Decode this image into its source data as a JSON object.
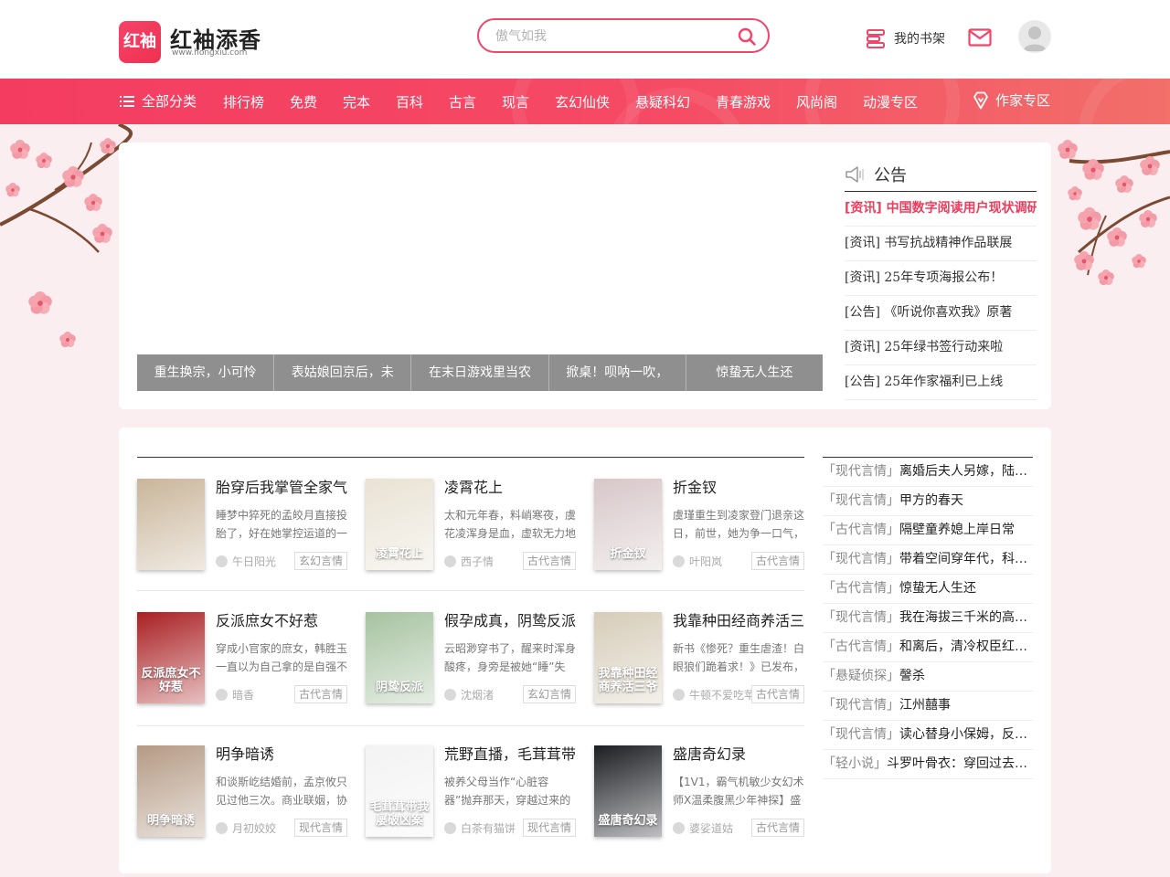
{
  "header": {
    "logo_badge": "红袖",
    "logo_name": "红袖添香",
    "logo_url": "www.hongxiu.com",
    "search_placeholder": "傲气如我",
    "shelf_label": "我的书架"
  },
  "nav": {
    "all_label": "全部分类",
    "items": [
      "排行榜",
      "免费",
      "完本",
      "百科",
      "古言",
      "现言",
      "玄幻仙侠",
      "悬疑科幻",
      "青春游戏",
      "风尚阁",
      "动漫专区"
    ],
    "writer_label": "作家专区"
  },
  "banner": {
    "tabs": [
      "重生换宗，小可怜",
      "表姑娘回京后，未",
      "在末日游戏里当农",
      "掀桌！呗呐一吹，",
      "惊蛰无人生还"
    ]
  },
  "notice": {
    "title": "公告",
    "items": [
      "[资讯] 中国数字阅读用户现状调研",
      "[资讯] 书写抗战精神作品联展",
      "[资讯] 25年专项海报公布！",
      "[公告] 《听说你喜欢我》原著",
      "[资讯] 25年绿书签行动来啦",
      "[公告] 25年作家福利已上线"
    ]
  },
  "books": [
    {
      "title": "胎穿后我掌管全家气",
      "desc": "睡梦中猝死的孟皎月直接投胎了，好在她掌控运道的一",
      "author": "午日阳光",
      "tag": "玄幻言情",
      "cover_text": "",
      "cover_color": "#c9b59a"
    },
    {
      "title": "凌霄花上",
      "desc": "太和元年春，料峭寒夜，虞花凌浑身是血，虚软无力地",
      "author": "西子情",
      "tag": "古代言情",
      "cover_text": "凌霄花上",
      "cover_color": "#e9e2d4"
    },
    {
      "title": "折金钗",
      "desc": "虞瑾重生到凌家登门退亲这日，前世，她为争一口气，",
      "author": "叶阳岚",
      "tag": "古代言情",
      "cover_text": "折金钗",
      "cover_color": "#d7c7c9"
    },
    {
      "title": "反派庶女不好惹",
      "desc": "穿成小官家的庶女，韩胜玉一直以为自己拿的是自强不",
      "author": "暗香",
      "tag": "古代言情",
      "cover_text": "反派庶女不好惹",
      "cover_color": "#a91f22"
    },
    {
      "title": "假孕成真，阴鸷反派",
      "desc": "云昭渺穿书了，醒来时浑身酸疼，身旁是被她“睡”失忆",
      "author": "沈烟渚",
      "tag": "玄幻言情",
      "cover_text": "阴鸷反派",
      "cover_color": "#a6c2a0"
    },
    {
      "title": "我靠种田经商养活三",
      "desc": "新书《惨死？重生虐渣！白眼狼们跪着求！》已发布，",
      "author": "牛顿不爱吃苹",
      "tag": "古代言情",
      "cover_text": "我靠种田经商养活三爷",
      "cover_color": "#d6ccb8"
    },
    {
      "title": "明争暗诱",
      "desc": "和谈斯屹结婚前，孟京攸只见过他三次。商业联姻，协",
      "author": "月初姣姣",
      "tag": "现代言情",
      "cover_text": "明争暗诱",
      "cover_color": "#b49a84"
    },
    {
      "title": "荒野直播，毛茸茸带",
      "desc": "被养父母当作“心脏容器”抛弃那天，穿越过来的阮未迟",
      "author": "白茶有猫饼",
      "tag": "现代言情",
      "cover_text": "毛茸茸带我屡破凶案",
      "cover_color": "#f3f3f3"
    },
    {
      "title": "盛唐奇幻录",
      "desc": "【1V1，霸气机敏少女幻术师X温柔腹黑少年神探】盛",
      "author": "婆娑道姑",
      "tag": "古代言情",
      "cover_text": "盛唐奇幻录",
      "cover_color": "#1c1d22"
    }
  ],
  "ranking": [
    {
      "cat": "「现代言情」",
      "name": "离婚后夫人另嫁，陆总追妻火葬场"
    },
    {
      "cat": "「现代言情」",
      "name": "甲方的春天"
    },
    {
      "cat": "「古代言情」",
      "name": "隔壁童养媳上岸日常"
    },
    {
      "cat": "「现代言情」",
      "name": "带着空间穿年代，科研大佬飒爆了"
    },
    {
      "cat": "「古代言情」",
      "name": "惊蛰无人生还"
    },
    {
      "cat": "「现代言情」",
      "name": "我在海拔三千米的高原当医生"
    },
    {
      "cat": "「古代言情」",
      "name": "和离后，清冷权臣红眼求复合"
    },
    {
      "cat": "「悬疑侦探」",
      "name": "謦杀"
    },
    {
      "cat": "「现代言情」",
      "name": "江州囍事"
    },
    {
      "cat": "「现代言情」",
      "name": "读心替身小保姆，反派大佬宠上天"
    },
    {
      "cat": "「轻小说」",
      "name": "斗罗叶骨衣：穿回过去拯救自己"
    }
  ],
  "colors": {
    "accent": "#f2456a",
    "nav_gradient_start": "#f43c61",
    "nav_gradient_end": "#f26f6a",
    "notice_active": "#ee3c5c"
  }
}
